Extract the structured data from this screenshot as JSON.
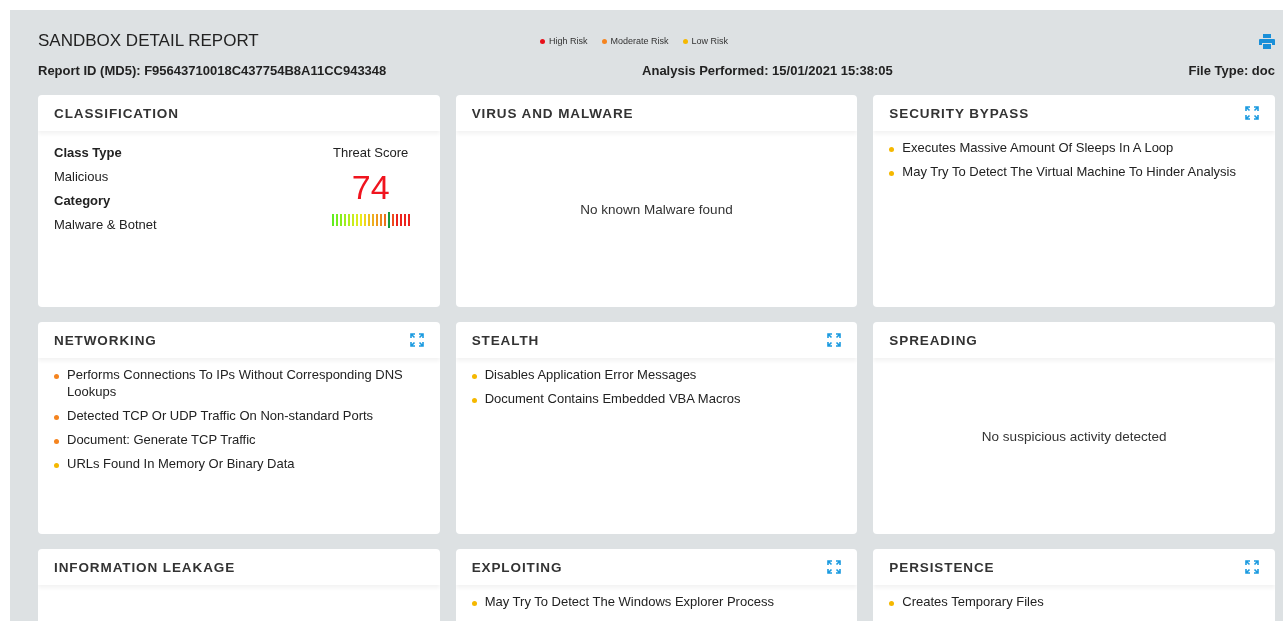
{
  "report": {
    "title": "SANDBOX DETAIL REPORT",
    "report_id": "Report ID (MD5): F95643710018C437754B8A11CC943348",
    "analysis": "Analysis Performed: 15/01/2021 15:38:05",
    "file_type": "File Type: doc"
  },
  "legend": [
    {
      "label": "High Risk",
      "color": "#e8101a"
    },
    {
      "label": "Moderate Risk",
      "color": "#f5841f"
    },
    {
      "label": "Low Risk",
      "color": "#f5b800"
    }
  ],
  "cards": [
    {
      "kind": "classification",
      "title": "CLASSIFICATION",
      "expandable": false,
      "class_type_label": "Class Type",
      "class_type": "Malicious",
      "category_label": "Category",
      "category": "Malware & Botnet",
      "score_label": "Threat Score",
      "score": "74",
      "level": 0.74
    },
    {
      "kind": "message",
      "title": "VIRUS AND MALWARE",
      "expandable": false,
      "message": "No known Malware found"
    },
    {
      "kind": "findings",
      "title": "SECURITY BYPASS",
      "expandable": true,
      "items": [
        {
          "text": "Executes Massive Amount Of Sleeps In A Loop",
          "color": "#f5b800"
        },
        {
          "text": "May Try To Detect The Virtual Machine To Hinder Analysis",
          "color": "#f5b800"
        }
      ]
    },
    {
      "kind": "findings",
      "title": "NETWORKING",
      "expandable": true,
      "items": [
        {
          "text": "Performs Connections To IPs Without Corresponding DNS Lookups",
          "color": "#f5841f"
        },
        {
          "text": "Detected TCP Or UDP Traffic On Non-standard Ports",
          "color": "#f5841f"
        },
        {
          "text": "Document: Generate TCP Traffic",
          "color": "#f5841f"
        },
        {
          "text": "URLs Found In Memory Or Binary Data",
          "color": "#f5b800"
        }
      ]
    },
    {
      "kind": "findings",
      "title": "STEALTH",
      "expandable": true,
      "items": [
        {
          "text": "Disables Application Error Messages",
          "color": "#f5b800"
        },
        {
          "text": "Document Contains Embedded VBA Macros",
          "color": "#f5b800"
        }
      ]
    },
    {
      "kind": "message",
      "title": "SPREADING",
      "expandable": false,
      "message": "No suspicious activity detected"
    },
    {
      "kind": "findings",
      "title": "INFORMATION LEAKAGE",
      "expandable": false
    },
    {
      "kind": "findings",
      "title": "EXPLOITING",
      "expandable": true,
      "items": [
        {
          "text": "May Try To Detect The Windows Explorer Process",
          "color": "#f5b800"
        }
      ]
    },
    {
      "kind": "findings",
      "title": "PERSISTENCE",
      "expandable": true,
      "items": [
        {
          "text": "Creates Temporary Files",
          "color": "#f5b800"
        }
      ]
    }
  ]
}
